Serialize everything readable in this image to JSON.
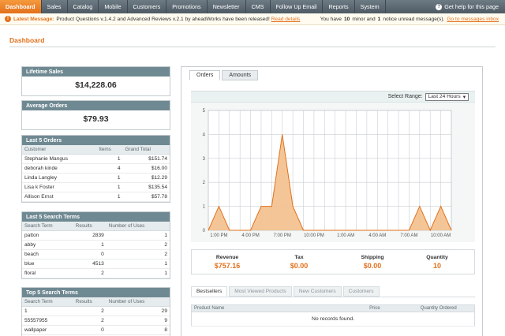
{
  "nav": {
    "items": [
      "Dashboard",
      "Sales",
      "Catalog",
      "Mobile",
      "Customers",
      "Promotions",
      "Newsletter",
      "CMS",
      "Follow Up Email",
      "Reports",
      "System"
    ],
    "help": "Get help for this page"
  },
  "message": {
    "label": "Latest Message:",
    "text": "Product Questions v.1.4.2 and Advanced Reviews v.2.1 by aheadWorks have been released!",
    "link": "Read details",
    "right_prefix": "You have",
    "right_count_minor": "10",
    "right_middle": "minor and",
    "right_count_notice": "1",
    "right_suffix": "notice unread message(s).",
    "right_link": "Go to messages inbox"
  },
  "page_title": "Dashboard",
  "lifetime_sales": {
    "title": "Lifetime Sales",
    "value": "$14,228.06"
  },
  "average_orders": {
    "title": "Average Orders",
    "value": "$79.93"
  },
  "last_orders": {
    "title": "Last 5 Orders",
    "headers": [
      "Customer",
      "Items",
      "Grand Total"
    ],
    "rows": [
      [
        "Stephanie Mangus",
        "1",
        "$151.74"
      ],
      [
        "deborah kinde",
        "4",
        "$16.00"
      ],
      [
        "Linda Langley",
        "1",
        "$12.29"
      ],
      [
        "Lisa k Foster",
        "1",
        "$135.54"
      ],
      [
        "Allison Ernst",
        "1",
        "$57.78"
      ]
    ]
  },
  "last_search": {
    "title": "Last 5 Search Terms",
    "headers": [
      "Search Term",
      "Results",
      "Number of Uses"
    ],
    "rows": [
      [
        "patton",
        "2839",
        "1"
      ],
      [
        "abby",
        "1",
        "2"
      ],
      [
        "beach",
        "0",
        "2"
      ],
      [
        "blue",
        "4513",
        "1"
      ],
      [
        "floral",
        "2",
        "1"
      ]
    ]
  },
  "top_search": {
    "title": "Top 5 Search Terms",
    "headers": [
      "Search Term",
      "Results",
      "Number of Uses"
    ],
    "rows": [
      [
        "1",
        "2",
        "29"
      ],
      [
        "55557955",
        "2",
        "9"
      ],
      [
        "wallpaper",
        "0",
        "8"
      ]
    ]
  },
  "chart_tabs": [
    "Orders",
    "Amounts"
  ],
  "range": {
    "label": "Select Range:",
    "value": "Last 24 Hours"
  },
  "chart_data": {
    "type": "area",
    "x_tick_labels": [
      "1:00 PM",
      "4:00 PM",
      "7:00 PM",
      "10:00 PM",
      "1:00 AM",
      "4:00 AM",
      "7:00 AM",
      "10:00 AM"
    ],
    "ylim": [
      0,
      5
    ],
    "y_ticks": [
      0,
      1,
      2,
      3,
      4,
      5
    ],
    "values": [
      0,
      1,
      0,
      0,
      0,
      1,
      1,
      4,
      1,
      0,
      0,
      0,
      0,
      0,
      0,
      0,
      0,
      0,
      0,
      0,
      1,
      0,
      1,
      0
    ],
    "grid": true,
    "color": "#f3c08c",
    "line_color": "#e2701b"
  },
  "totals": [
    {
      "label": "Revenue",
      "value": "$757.16"
    },
    {
      "label": "Tax",
      "value": "$0.00"
    },
    {
      "label": "Shipping",
      "value": "$0.00"
    },
    {
      "label": "Quantity",
      "value": "10"
    }
  ],
  "bottom_tabs": [
    "Bestsellers",
    "Most Viewed Products",
    "New Customers",
    "Customers"
  ],
  "bestsellers": {
    "headers": [
      "Product Name",
      "Price",
      "Quantity Ordered"
    ],
    "empty": "No records found."
  }
}
